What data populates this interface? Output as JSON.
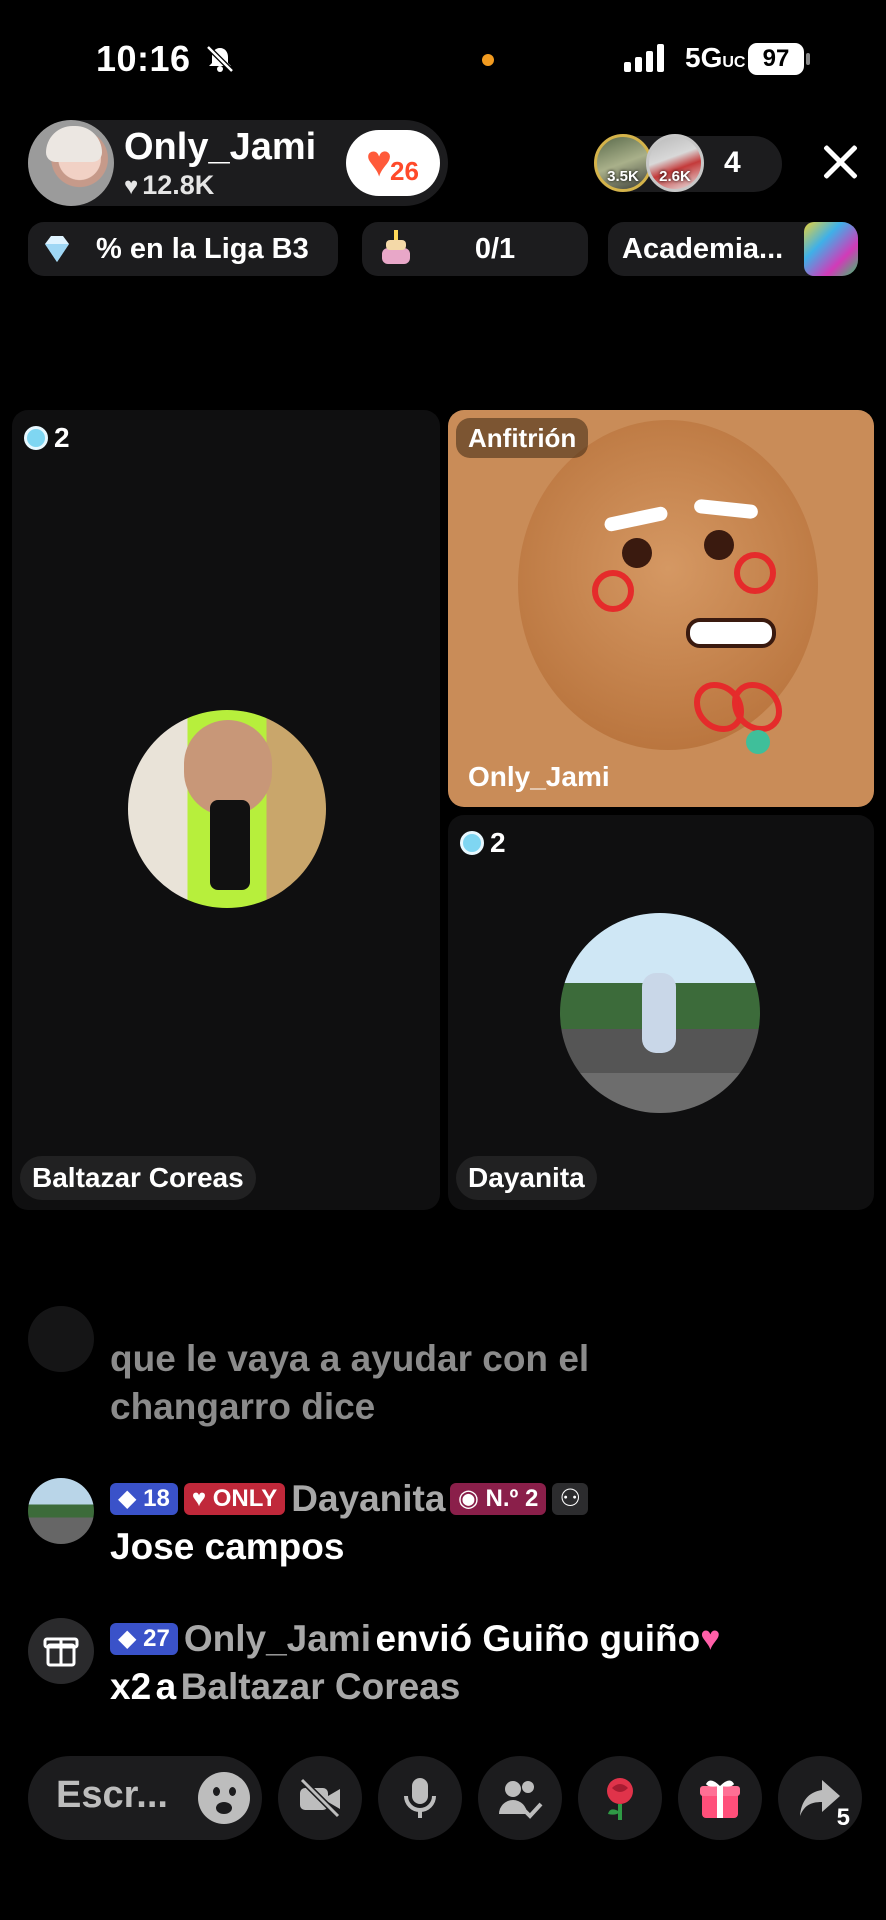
{
  "status_bar": {
    "time": "10:16",
    "network": "5G",
    "network_suffix": "UC",
    "battery": "97"
  },
  "host": {
    "name": "Only_Jami",
    "likes": "12.8K",
    "fan_level": "26"
  },
  "viewers": {
    "top": [
      {
        "count": "3.5K"
      },
      {
        "count": "2.6K"
      }
    ],
    "total": "4"
  },
  "chips": {
    "league": "% en la Liga B3",
    "goal": "0/1",
    "academy": "Academia..."
  },
  "grid": {
    "left": {
      "badge_count": "2",
      "name": "Baltazar Coreas"
    },
    "host": {
      "badge": "Anfitrión",
      "name": "Only_Jami"
    },
    "right": {
      "badge_count": "2",
      "name": "Dayanita"
    }
  },
  "chat": [
    {
      "line1": "que le vaya a ayudar con el",
      "line2": "changarro dice"
    },
    {
      "level": "18",
      "fan_tag": "ONLY",
      "user": "Dayanita",
      "rank": "N.º 2",
      "message": "Jose campos"
    },
    {
      "level": "27",
      "user": "Only_Jami",
      "action": "envió Guiño guiño",
      "count": "x2",
      "to_word": "a",
      "recipient": "Baltazar Coreas"
    }
  ],
  "bottom": {
    "comment_placeholder": "Escr...",
    "share_count": "5"
  },
  "colors": {
    "accent_orange": "#f29b20",
    "host_tile": "#c98c58",
    "panel": "#1c1c1e"
  }
}
